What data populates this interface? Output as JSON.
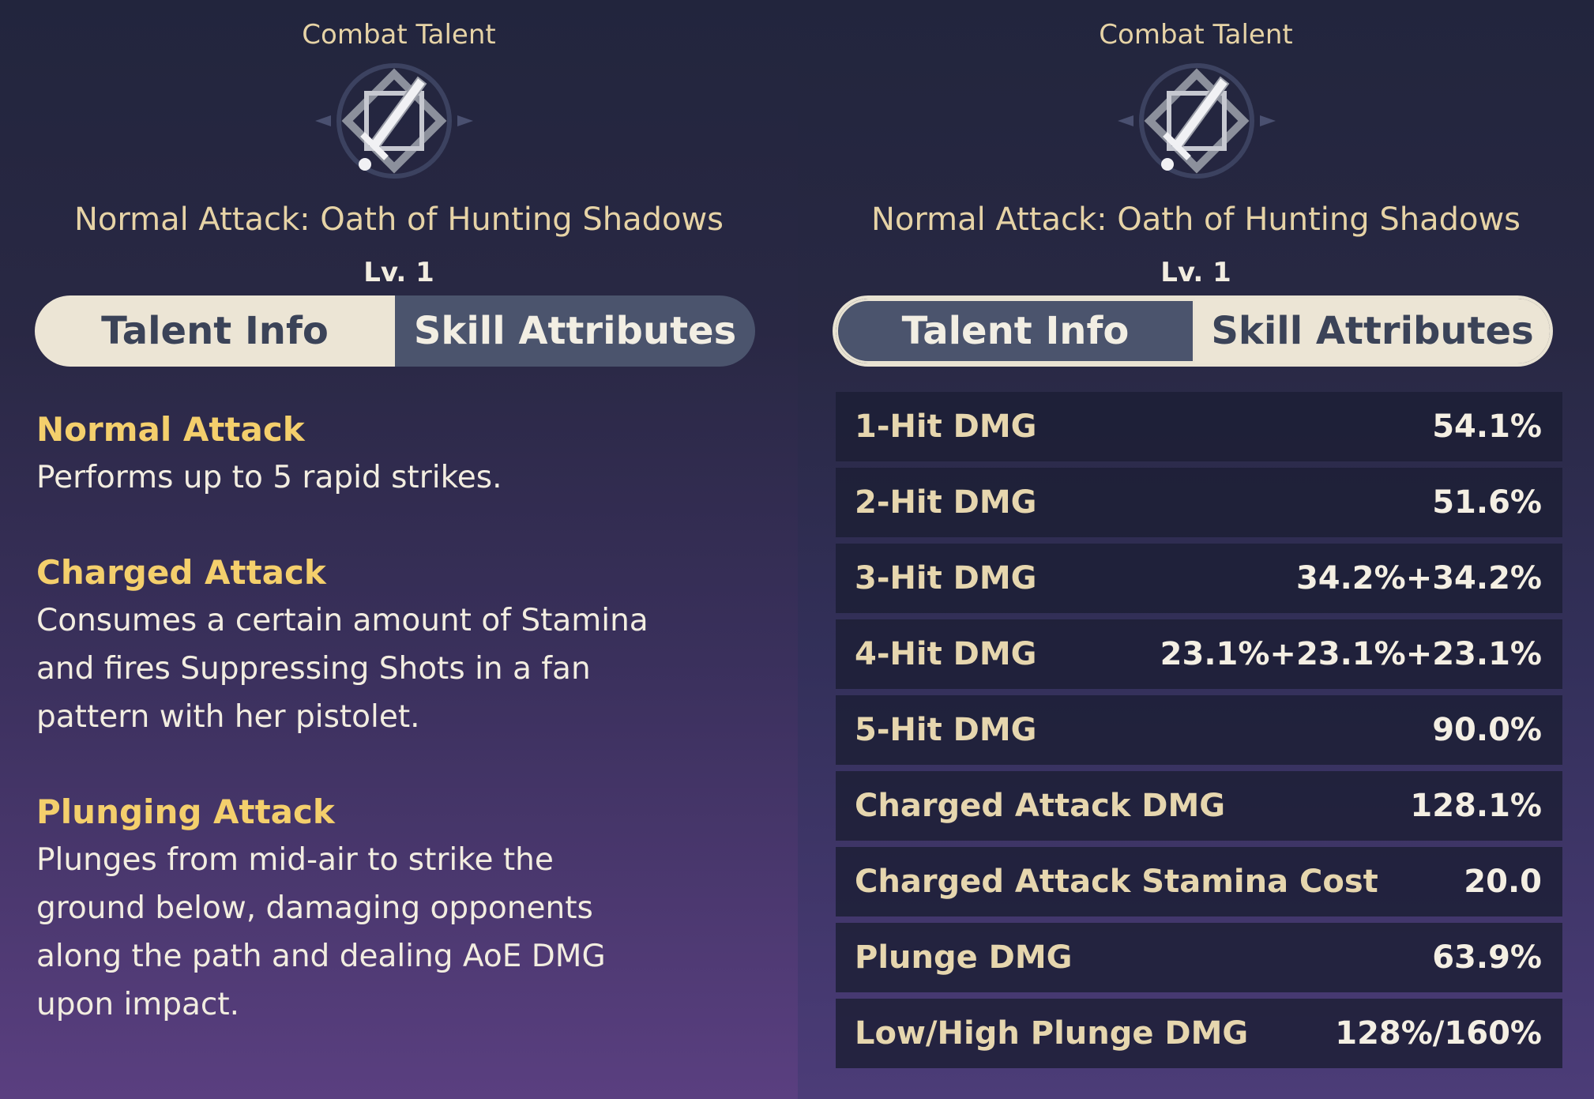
{
  "left_panel": {
    "category": "Combat Talent",
    "skill_name": "Normal Attack: Oath of Hunting Shadows",
    "level": "Lv. 1",
    "tabs": {
      "talent_info": "Talent Info",
      "skill_attributes": "Skill Attributes"
    },
    "active_tab": "Talent Info",
    "sections": [
      {
        "heading": "Normal Attack",
        "text": [
          "Performs up to 5 rapid strikes."
        ]
      },
      {
        "heading": "Charged Attack",
        "text": [
          "Consumes a certain amount of Stamina",
          "and fires Suppressing Shots in a fan",
          "pattern with her pistolet."
        ]
      },
      {
        "heading": "Plunging Attack",
        "text": [
          "Plunges from mid-air to strike the",
          "ground below, damaging opponents",
          "along the path and dealing AoE DMG",
          "upon impact."
        ]
      }
    ]
  },
  "right_panel": {
    "category": "Combat Talent",
    "skill_name": "Normal Attack: Oath of Hunting Shadows",
    "level": "Lv. 1",
    "tabs": {
      "talent_info": "Talent Info",
      "skill_attributes": "Skill Attributes"
    },
    "active_tab": "Skill Attributes",
    "attributes": [
      {
        "name": "1-Hit DMG",
        "value": "54.1%"
      },
      {
        "name": "2-Hit DMG",
        "value": "51.6%"
      },
      {
        "name": "3-Hit DMG",
        "value": "34.2%+34.2%"
      },
      {
        "name": "4-Hit DMG",
        "value": "23.1%+23.1%+23.1%"
      },
      {
        "name": "5-Hit DMG",
        "value": "90.0%"
      },
      {
        "name": "Charged Attack DMG",
        "value": "128.1%"
      },
      {
        "name": "Charged Attack Stamina Cost",
        "value": "20.0"
      },
      {
        "name": "Plunge DMG",
        "value": "63.9%"
      },
      {
        "name": "Low/High Plunge DMG",
        "value": "128%/160%"
      }
    ]
  },
  "colors": {
    "gold_heading": "#f4cf6c",
    "beige_text": "#e6d3a6",
    "toggle_light": "#ece5d5",
    "toggle_dark": "#4b546d"
  },
  "icons": {
    "talent_icon": "sword-emblem-icon"
  }
}
